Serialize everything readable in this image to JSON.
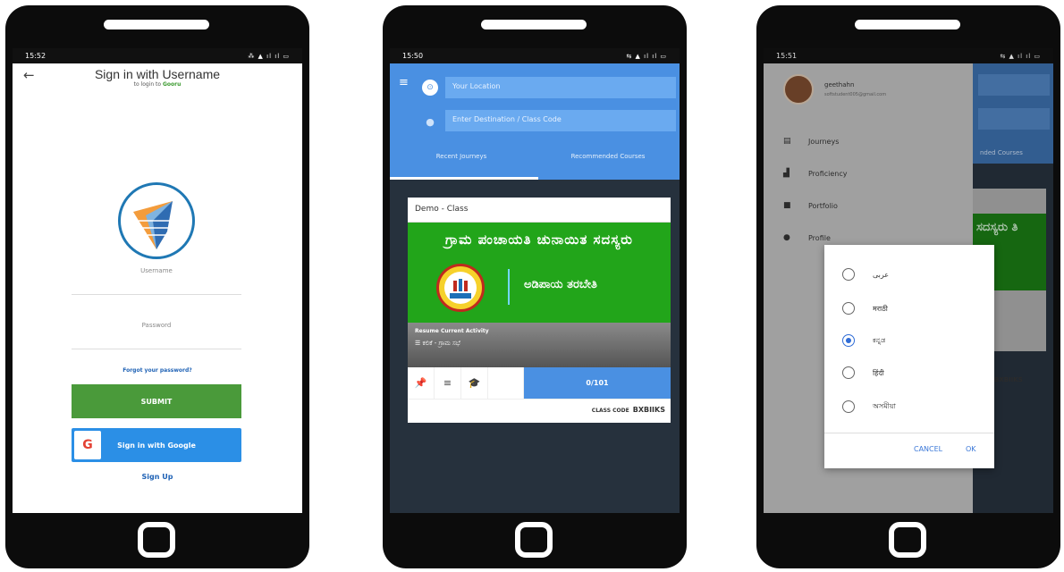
{
  "screen1": {
    "time": "15:52",
    "status_icons": "⁂ ▲ ıl ıl ▭",
    "title": "Sign in with Username",
    "subtitle_prefix": "to login to ",
    "subtitle_brand": "Gooru",
    "username_placeholder": "Username",
    "password_placeholder": "Password",
    "forgot": "Forgot your password?",
    "submit": "SUBMIT",
    "google": "Sign in with Google",
    "signup": "Sign Up"
  },
  "screen2": {
    "time": "15:50",
    "status_icons": "⇆ ▲ ıl ıl ▭",
    "your_location": "Your Location",
    "destination": "Enter Destination / Class Code",
    "tabs": [
      "Recent Journeys",
      "Recommended Courses"
    ],
    "card_title": "Demo - Class",
    "banner_title": "ಗ್ರಾಮ ಪಂಚಾಯತಿ ಚುನಾಯಿತ ಸದಸ್ಯರು",
    "banner_sub": "ಅಡಿಪಾಯ ತರಬೇತಿ",
    "resume_label": "Resume Current Activity",
    "resume_activity": "ಕಲಿಕೆ - ಗ್ರಾಮ ಸಭೆ",
    "progress": "0/101",
    "class_code_label": "CLASS CODE",
    "class_code": "BXBIIKS"
  },
  "screen3": {
    "time": "15:51",
    "status_icons": "⇆ ▲ ıl ıl ▭",
    "user_name": "geethahn",
    "user_email": "softstudent005@gmail.com",
    "nav": [
      "Journeys",
      "Proficiency",
      "Portfolio",
      "Profile"
    ],
    "right_tab": "nded Courses",
    "right_banner": "ಸದಸ್ಯರು ತಿ",
    "right_code": "BXBIIKS",
    "languages": [
      "عربى",
      "मराठी",
      "ಕನ್ನಡ",
      "हिंदी",
      "অসমীয়া"
    ],
    "selected_language": "ಕನ್ನಡ",
    "cancel": "CANCEL",
    "ok": "OK"
  },
  "colors": {
    "green": "#4a9a3a",
    "blue": "#4a90e2",
    "google_blue": "#2b8fe6"
  }
}
